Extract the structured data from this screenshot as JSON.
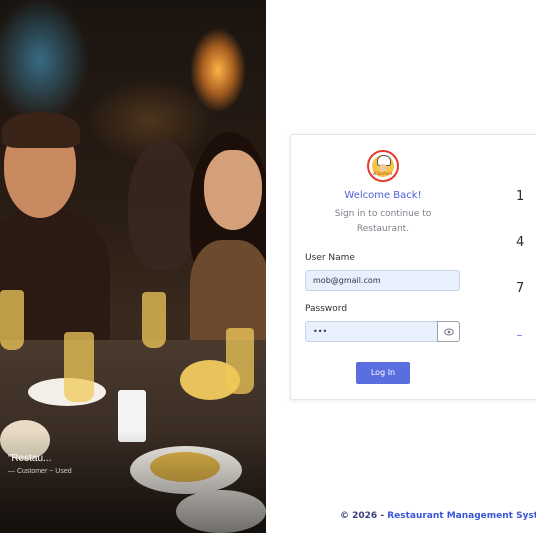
{
  "photo": {
    "quote": "“Restau...",
    "quote_sub": "— Customer ~ Used"
  },
  "login": {
    "logo_text": "Kitchen",
    "welcome": "Welcome Back!",
    "subtitle": "Sign in to continue to Restaurant.",
    "username_label": "User Name",
    "username_value": "mob@gmail.com",
    "password_label": "Password",
    "password_value": "•••",
    "login_button": "Log In",
    "steps": [
      "1",
      "4",
      "7"
    ]
  },
  "footer": {
    "copyright": "© 2026 - ",
    "brand": "Restaurant Management Syste"
  },
  "colors": {
    "accent": "#5a6ee0",
    "welcome": "#4a60d8",
    "input_bg": "#e8f0fe"
  }
}
